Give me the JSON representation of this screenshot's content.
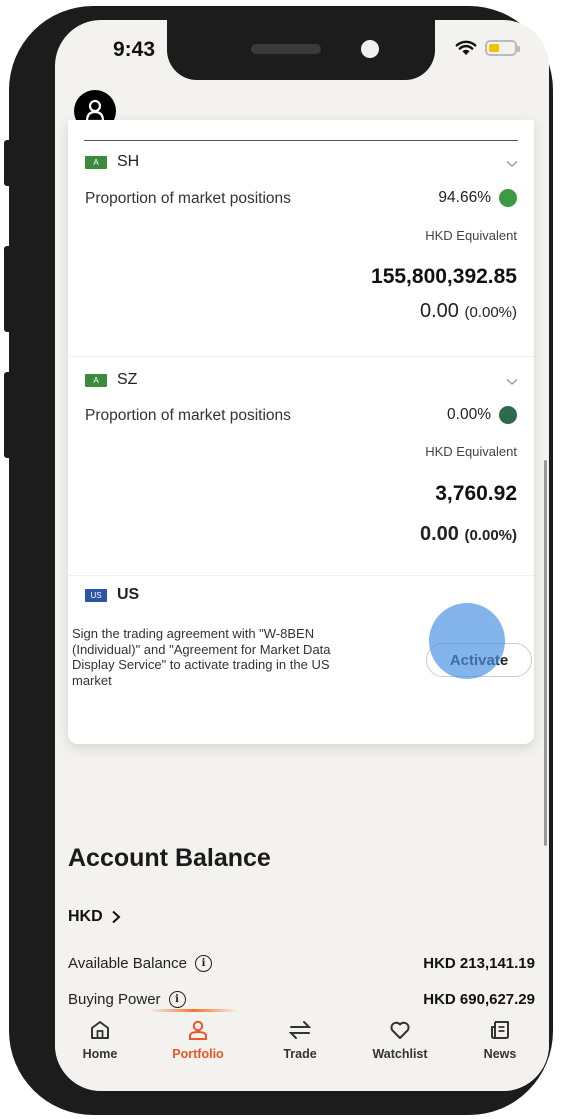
{
  "status_bar": {
    "time": "9:43"
  },
  "markets": [
    {
      "badge": "A",
      "code": "SH",
      "proportion_label": "Proportion of market positions",
      "proportion_value": "94.66%",
      "dot_color": "#3c9a46",
      "equivalent_label": "HKD Equivalent",
      "amount": "155,800,392.85",
      "change": "0.00",
      "change_pct": "(0.00%)"
    },
    {
      "badge": "A",
      "code": "SZ",
      "proportion_label": "Proportion of market positions",
      "proportion_value": "0.00%",
      "dot_color": "#2e6b4e",
      "equivalent_label": "HKD Equivalent",
      "amount": "3,760.92",
      "change": "0.00",
      "change_pct": "(0.00%)"
    }
  ],
  "us_market": {
    "badge": "US",
    "code": "US",
    "description": "Sign the trading agreement with \"W-8BEN (Individual)\" and \"Agreement for Market Data Display Service\" to activate trading in the US market",
    "activate_label": "Activate"
  },
  "account_balance": {
    "title": "Account Balance",
    "currency": "HKD",
    "rows": [
      {
        "label": "Available Balance",
        "value": "HKD 213,141.19"
      },
      {
        "label": "Buying Power",
        "value": "HKD 690,627.29"
      }
    ]
  },
  "tabs": [
    {
      "label": "Home",
      "icon": "home-icon"
    },
    {
      "label": "Portfolio",
      "icon": "person-icon",
      "active": true
    },
    {
      "label": "Trade",
      "icon": "swap-icon"
    },
    {
      "label": "Watchlist",
      "icon": "heart-icon"
    },
    {
      "label": "News",
      "icon": "news-icon"
    }
  ],
  "colors": {
    "accent": "#e8562a",
    "badge_a": "#3c8a3c",
    "badge_us": "#2a56a8"
  }
}
